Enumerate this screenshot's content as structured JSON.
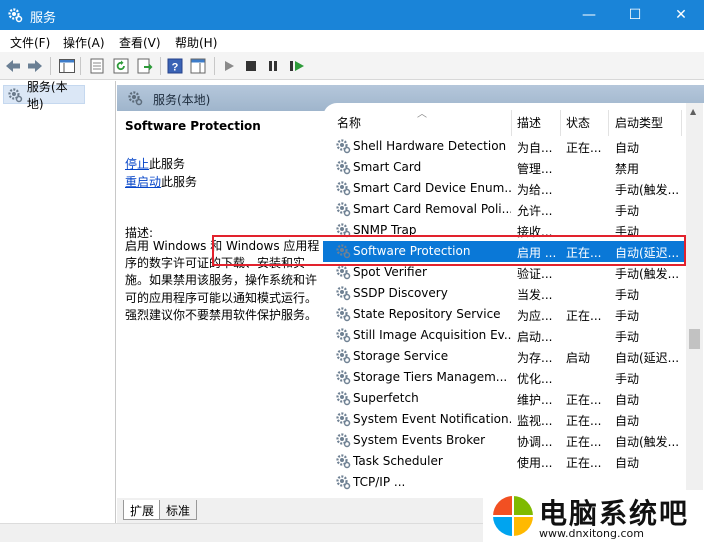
{
  "window": {
    "title": "服务",
    "min_glyph": "—",
    "max_glyph": "☐",
    "close_glyph": "✕"
  },
  "menu": [
    {
      "label": "文件(F)"
    },
    {
      "label": "操作(A)"
    },
    {
      "label": "查看(V)"
    },
    {
      "label": "帮助(H)"
    }
  ],
  "toolbar": {
    "icons": [
      "back-arrow-icon",
      "forward-arrow-icon",
      "show-tree-icon",
      "properties-icon",
      "refresh-icon",
      "export-list-icon",
      "help-icon",
      "show-action-pane-icon",
      "start-service-icon",
      "stop-service-icon",
      "pause-service-icon",
      "restart-service-icon"
    ]
  },
  "tree": {
    "root_label": "服务(本地)"
  },
  "header": {
    "label": "服务(本地)"
  },
  "details": {
    "service_name": "Software Protection",
    "stop_link": "停止",
    "stop_suffix": "此服务",
    "restart_link": "重启动",
    "restart_suffix": "此服务",
    "desc_label": "描述:",
    "desc_text": "启用 Windows 和 Windows 应用程序的数字许可证的下载、安装和实施。如果禁用该服务，操作系统和许可的应用程序可能以通知模式运行。强烈建议你不要禁用软件保护服务。"
  },
  "columns": {
    "name": "名称",
    "desc": "描述",
    "status": "状态",
    "startup": "启动类型"
  },
  "rows": [
    {
      "name": "Shell Hardware Detection",
      "desc": "为自...",
      "status": "正在...",
      "startup": "自动"
    },
    {
      "name": "Smart Card",
      "desc": "管理...",
      "status": "",
      "startup": "禁用"
    },
    {
      "name": "Smart Card Device Enum...",
      "desc": "为给...",
      "status": "",
      "startup": "手动(触发..."
    },
    {
      "name": "Smart Card Removal Poli...",
      "desc": "允许...",
      "status": "",
      "startup": "手动"
    },
    {
      "name": "SNMP Trap",
      "desc": "接收...",
      "status": "",
      "startup": "手动"
    },
    {
      "name": "Software Protection",
      "desc": "启用 ...",
      "status": "正在...",
      "startup": "自动(延迟...",
      "selected": true
    },
    {
      "name": "Spot Verifier",
      "desc": "验证...",
      "status": "",
      "startup": "手动(触发..."
    },
    {
      "name": "SSDP Discovery",
      "desc": "当发...",
      "status": "",
      "startup": "手动"
    },
    {
      "name": "State Repository Service",
      "desc": "为应...",
      "status": "正在...",
      "startup": "手动"
    },
    {
      "name": "Still Image Acquisition Ev...",
      "desc": "启动...",
      "status": "",
      "startup": "手动"
    },
    {
      "name": "Storage Service",
      "desc": "为存...",
      "status": "启动",
      "startup": "自动(延迟..."
    },
    {
      "name": "Storage Tiers Managem...",
      "desc": "优化...",
      "status": "",
      "startup": "手动"
    },
    {
      "name": "Superfetch",
      "desc": "维护...",
      "status": "正在...",
      "startup": "自动"
    },
    {
      "name": "System Event Notification...",
      "desc": "监视...",
      "status": "正在...",
      "startup": "自动"
    },
    {
      "name": "System Events Broker",
      "desc": "协调...",
      "status": "正在...",
      "startup": "自动(触发..."
    },
    {
      "name": "Task Scheduler",
      "desc": "使用...",
      "status": "正在...",
      "startup": "自动"
    },
    {
      "name": "TCP/IP ...",
      "desc": "",
      "status": "",
      "startup": ""
    }
  ],
  "tabs": [
    {
      "label": "扩展"
    },
    {
      "label": "标准"
    }
  ],
  "watermark": {
    "name": "电脑系统吧",
    "url": "www.dnxitong.com"
  },
  "colors": {
    "title_bar": "#1a84d8",
    "selection": "#0a78d7",
    "highlight_box": "#e2222d",
    "link": "#0645c8"
  }
}
